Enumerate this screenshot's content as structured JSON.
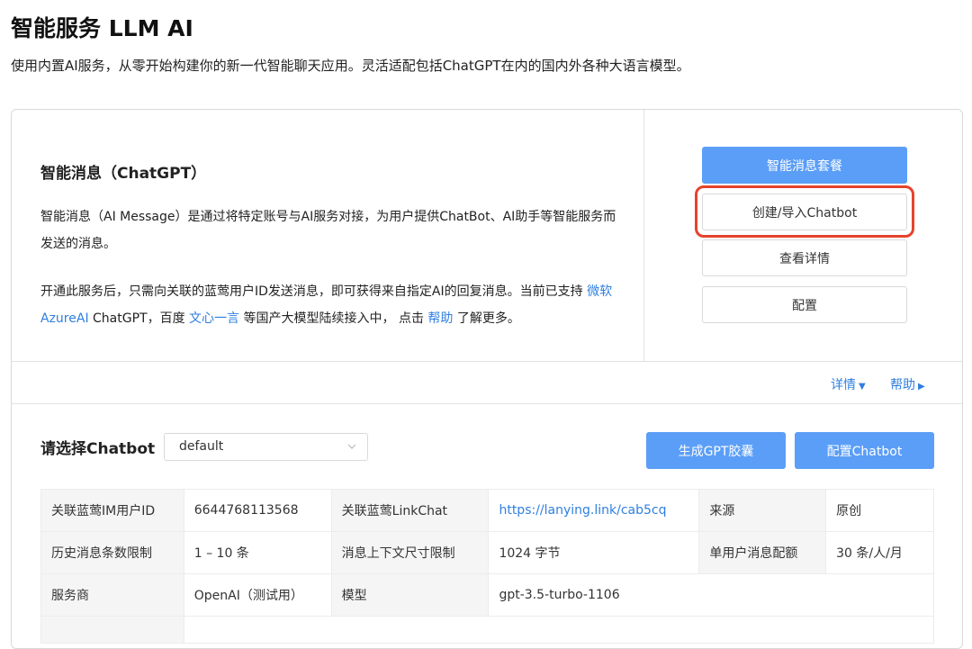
{
  "header": {
    "title": "智能服务 LLM AI",
    "subtitle": "使用内置AI服务，从零开始构建你的新一代智能聊天应用。灵活适配包括ChatGPT在内的国内外各种大语言模型。"
  },
  "service": {
    "title": "智能消息（ChatGPT）",
    "desc1": "智能消息（AI Message）是通过将特定账号与AI服务对接，为用户提供ChatBot、AI助手等智能服务而发送的消息。",
    "desc2_part1": "开通此服务后，只需向关联的蓝莺用户ID发送消息，即可获得来自指定AI的回复消息。当前已支持 ",
    "desc2_link1": "微软AzureAI",
    "desc2_part2": " ChatGPT，百度 ",
    "desc2_link2": "文心一言",
    "desc2_part3": " 等国产大模型陆续接入中， 点击 ",
    "desc2_link3": "帮助",
    "desc2_part4": " 了解更多。"
  },
  "actions": {
    "package_label": "智能消息套餐",
    "create_label": "创建/导入Chatbot",
    "details_label": "查看详情",
    "config_label": "配置"
  },
  "links": {
    "detail": "详情",
    "help": "帮助"
  },
  "chatbot": {
    "label": "请选择Chatbot",
    "selected": "default",
    "gen_label": "生成GPT胶囊",
    "config_label": "配置Chatbot"
  },
  "info": {
    "rows": [
      [
        "关联蓝莺IM用户ID",
        "6644768113568",
        "关联蓝莺LinkChat",
        "https://lanying.link/cab5cq",
        "来源",
        "原创"
      ],
      [
        "历史消息条数限制",
        "1 – 10 条",
        "消息上下文尺寸限制",
        "1024 字节",
        "单用户消息配额",
        "30 条/人/月"
      ],
      [
        "服务商",
        "OpenAI（测试用）",
        "模型",
        "gpt-3.5-turbo-1106",
        "",
        ""
      ]
    ]
  },
  "colors": {
    "primary": "#5b9ef7",
    "link": "#2f7fe0",
    "highlight": "#e5432c"
  }
}
